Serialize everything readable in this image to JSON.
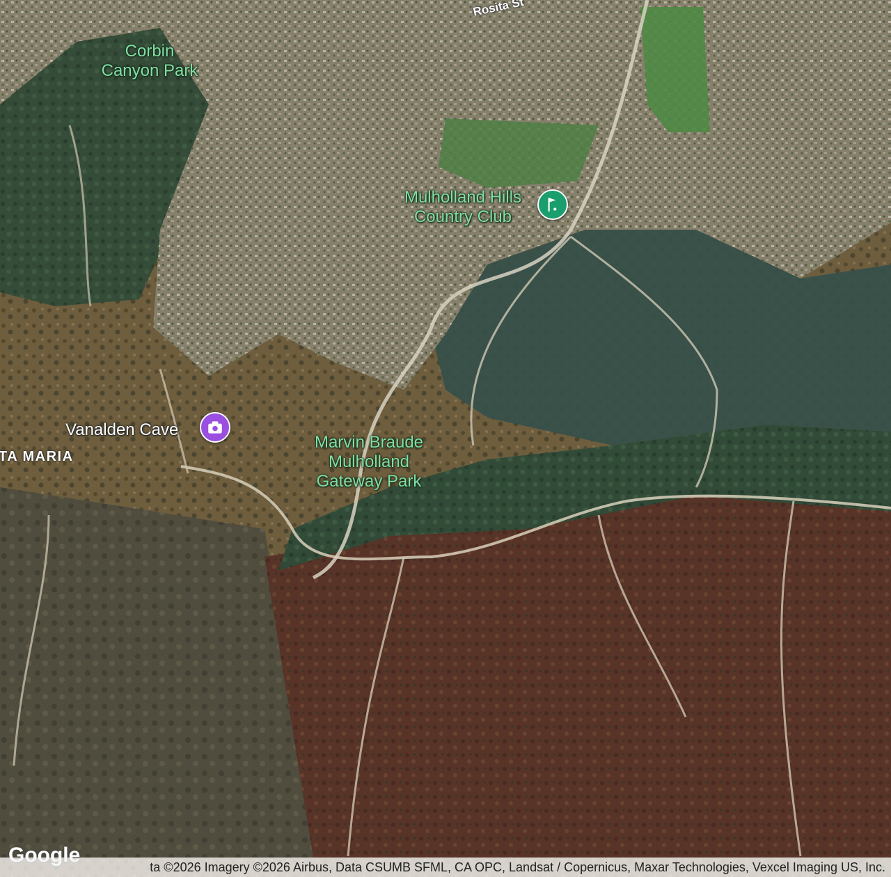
{
  "map": {
    "labels": {
      "corbin_canyon_park_line1": "Corbin",
      "corbin_canyon_park_line2": "Canyon Park",
      "rosita_st": "Rosita St",
      "mulholland_hills_line1": "Mulholland Hills",
      "mulholland_hills_line2": "Country Club",
      "vanalden_cave": "Vanalden Cave",
      "santa_maria_partial": "TA MARIA",
      "marvin_braude_line1": "Marvin Braude",
      "marvin_braude_line2": "Mulholland",
      "marvin_braude_line3": "Gateway Park"
    },
    "markers": {
      "golf": {
        "icon": "golf-icon",
        "color": "#1a9e6e"
      },
      "photo": {
        "icon": "camera-icon",
        "color": "#9b4fe0"
      }
    },
    "colors": {
      "park_label": "#7ee0a2",
      "urban": "#8b8672",
      "scrub": "#6b5c3e",
      "forest": "#2f4a36",
      "burn": "#5a3328"
    }
  },
  "footer": {
    "attribution": "ta ©2026 Imagery ©2026 Airbus, Data CSUMB SFML, CA OPC, Landsat / Copernicus, Maxar Technologies, Vexcel Imaging US, Inc.",
    "logo": "Google"
  }
}
